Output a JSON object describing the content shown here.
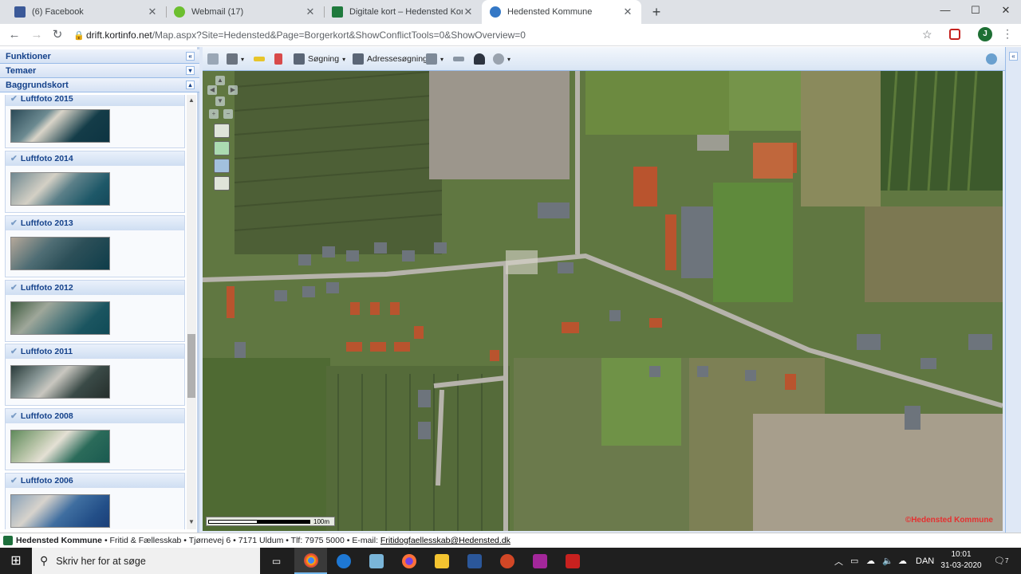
{
  "browser": {
    "tabs": [
      {
        "title": "(6) Facebook",
        "favicon_color": "#3b5998",
        "active": false
      },
      {
        "title": "Webmail (17)",
        "favicon_color": "#6cbf2f",
        "active": false
      },
      {
        "title": "Digitale kort – Hedensted Komm",
        "favicon_color": "#1f7a3d",
        "active": false
      },
      {
        "title": "Hedensted Kommune",
        "favicon_color": "#3478c6",
        "active": true
      }
    ],
    "new_tab_label": "+",
    "url_host": "drift.kortinfo.net",
    "url_path": "/Map.aspx?Site=Hedensted&Page=Borgerkort&ShowConflictTools=0&ShowOverview=0",
    "profile_initial": "J"
  },
  "sidebar": {
    "panels": [
      {
        "label": "Funktioner",
        "toggle": "«"
      },
      {
        "label": "Temaer",
        "toggle": "▾"
      },
      {
        "label": "Baggrundskort",
        "toggle": "▴"
      }
    ],
    "partial_top_label": "Luftfoto 2015",
    "background_maps": [
      {
        "label": "Luftfoto 2014"
      },
      {
        "label": "Luftfoto 2013"
      },
      {
        "label": "Luftfoto 2012"
      },
      {
        "label": "Luftfoto 2011"
      },
      {
        "label": "Luftfoto 2008"
      },
      {
        "label": "Luftfoto 2006"
      }
    ],
    "scroll_position": 0.55
  },
  "map_toolbar": {
    "buttons": [
      {
        "icon": "help-icon",
        "label": ""
      },
      {
        "icon": "print-icon",
        "label": ""
      },
      {
        "icon": "measure-icon",
        "label": ""
      },
      {
        "icon": "draw-icon",
        "label": ""
      },
      {
        "icon": "search-icon",
        "label": "Søgning"
      },
      {
        "icon": "address-search-icon",
        "label": "Adressesøgning"
      },
      {
        "icon": "layers-icon",
        "label": ""
      },
      {
        "icon": "link-icon",
        "label": ""
      },
      {
        "icon": "streetview-icon",
        "label": ""
      },
      {
        "icon": "settings-icon",
        "label": ""
      }
    ]
  },
  "map": {
    "scale_label": "100m",
    "copyright": "©Hedensted Kommune"
  },
  "footer": {
    "org": "Hedensted Kommune",
    "details": "• Fritid & Fællesskab • Tjørnevej 6 • 7171 Uldum • Tlf: 7975 5000 • E-mail:",
    "email": "Fritidogfaellesskab@Hedensted.dk"
  },
  "taskbar": {
    "search_placeholder": "Skriv her for at søge",
    "language": "DAN",
    "time": "10:01",
    "date": "31-03-2020",
    "notification_count": "7"
  }
}
